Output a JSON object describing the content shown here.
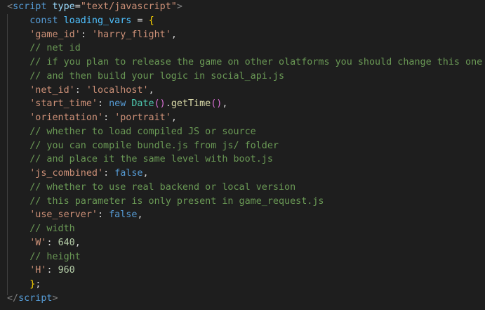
{
  "editor": {
    "colors": {
      "background": "#1e1e1e",
      "tag": "#569cd6",
      "attribute": "#9cdcfe",
      "string": "#ce9178",
      "keyword": "#569cd6",
      "constant": "#4fc1ff",
      "comment": "#6a9955",
      "function": "#dcdcaa",
      "class": "#4ec9b0",
      "number": "#b5cea8",
      "bracket_level1": "#ffd700",
      "bracket_level2": "#da70d6"
    },
    "lines": [
      [
        {
          "t": "<",
          "c": "t-gray"
        },
        {
          "t": "script",
          "c": "t-tag"
        },
        {
          "t": " "
        },
        {
          "t": "type",
          "c": "t-attr"
        },
        {
          "t": "="
        },
        {
          "t": "\"text/javascript\"",
          "c": "t-str"
        },
        {
          "t": ">",
          "c": "t-gray"
        }
      ],
      [
        {
          "t": "    "
        },
        {
          "t": "const",
          "c": "t-kw"
        },
        {
          "t": " "
        },
        {
          "t": "loading_vars",
          "c": "t-var"
        },
        {
          "t": " = "
        },
        {
          "t": "{",
          "c": "t-p1"
        }
      ],
      [
        {
          "t": "    "
        },
        {
          "t": "'game_id'",
          "c": "t-str"
        },
        {
          "t": ": "
        },
        {
          "t": "'harry_flight'",
          "c": "t-str"
        },
        {
          "t": ","
        }
      ],
      [
        {
          "t": "    "
        },
        {
          "t": "// net id",
          "c": "t-com"
        }
      ],
      [
        {
          "t": "    "
        },
        {
          "t": "// if you plan to release the game on other olatforms you should change this one",
          "c": "t-com"
        }
      ],
      [
        {
          "t": "    "
        },
        {
          "t": "// and then build your logic in social_api.js",
          "c": "t-com"
        }
      ],
      [
        {
          "t": "    "
        },
        {
          "t": "'net_id'",
          "c": "t-str"
        },
        {
          "t": ": "
        },
        {
          "t": "'localhost'",
          "c": "t-str"
        },
        {
          "t": ","
        }
      ],
      [
        {
          "t": "    "
        },
        {
          "t": "'start_time'",
          "c": "t-str"
        },
        {
          "t": ": "
        },
        {
          "t": "new",
          "c": "t-kw"
        },
        {
          "t": " "
        },
        {
          "t": "Date",
          "c": "t-cls"
        },
        {
          "t": "()",
          "c": "t-p2"
        },
        {
          "t": "."
        },
        {
          "t": "getTime",
          "c": "t-fn"
        },
        {
          "t": "()",
          "c": "t-p2"
        },
        {
          "t": ","
        }
      ],
      [
        {
          "t": "    "
        },
        {
          "t": "'orientation'",
          "c": "t-str"
        },
        {
          "t": ": "
        },
        {
          "t": "'portrait'",
          "c": "t-str"
        },
        {
          "t": ","
        }
      ],
      [
        {
          "t": "    "
        },
        {
          "t": "// whether to load compiled JS or source",
          "c": "t-com"
        }
      ],
      [
        {
          "t": "    "
        },
        {
          "t": "// you can compile bundle.js from js/ folder",
          "c": "t-com"
        }
      ],
      [
        {
          "t": "    "
        },
        {
          "t": "// and place it the same level with boot.js",
          "c": "t-com"
        }
      ],
      [
        {
          "t": "    "
        },
        {
          "t": "'js_combined'",
          "c": "t-str"
        },
        {
          "t": ": "
        },
        {
          "t": "false",
          "c": "t-kw"
        },
        {
          "t": ","
        }
      ],
      [
        {
          "t": "    "
        },
        {
          "t": "// whether to use real backend or local version",
          "c": "t-com"
        }
      ],
      [
        {
          "t": "    "
        },
        {
          "t": "// this parameter is only present in game_request.js",
          "c": "t-com"
        }
      ],
      [
        {
          "t": "    "
        },
        {
          "t": "'use_server'",
          "c": "t-str"
        },
        {
          "t": ": "
        },
        {
          "t": "false",
          "c": "t-kw"
        },
        {
          "t": ","
        }
      ],
      [
        {
          "t": "    "
        },
        {
          "t": "// width",
          "c": "t-com"
        }
      ],
      [
        {
          "t": "    "
        },
        {
          "t": "'W'",
          "c": "t-str"
        },
        {
          "t": ": "
        },
        {
          "t": "640",
          "c": "t-num"
        },
        {
          "t": ","
        }
      ],
      [
        {
          "t": "    "
        },
        {
          "t": "// height",
          "c": "t-com"
        }
      ],
      [
        {
          "t": "    "
        },
        {
          "t": "'H'",
          "c": "t-str"
        },
        {
          "t": ": "
        },
        {
          "t": "960",
          "c": "t-num"
        }
      ],
      [
        {
          "t": "    "
        },
        {
          "t": "}",
          "c": "t-p1"
        },
        {
          "t": ";"
        }
      ],
      [
        {
          "t": "</",
          "c": "t-gray"
        },
        {
          "t": "script",
          "c": "t-tag"
        },
        {
          "t": ">",
          "c": "t-gray"
        }
      ]
    ]
  }
}
